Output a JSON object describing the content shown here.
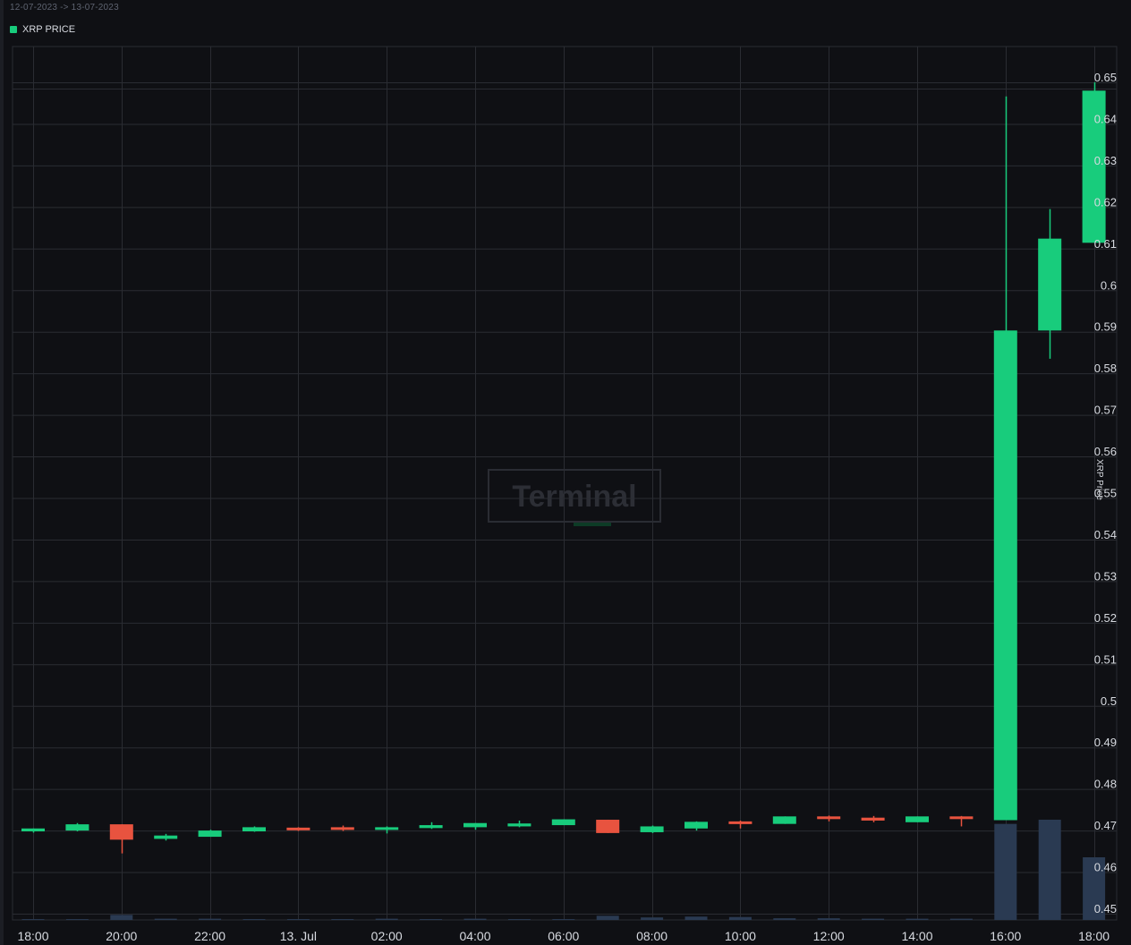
{
  "header": {
    "date_range": "12-07-2023 -> 13-07-2023",
    "legend_label": "XRP PRICE",
    "legend_color": "#18cc7c"
  },
  "watermark": {
    "text": "Terminal"
  },
  "colors": {
    "up": "#18cc7c",
    "down": "#e8533f",
    "volume": "#2a3a52",
    "grid": "#2a2c32",
    "axis_text": "#d7dae0"
  },
  "chart_data": {
    "type": "candlestick",
    "title": "",
    "series_name": "XRP PRICE",
    "ylabel": "XRP Price",
    "ylim": [
      0.45,
      0.655
    ],
    "y_ticks": [
      0.45,
      0.46,
      0.47,
      0.48,
      0.49,
      0.5,
      0.51,
      0.52,
      0.53,
      0.54,
      0.55,
      0.56,
      0.57,
      0.58,
      0.59,
      0.6,
      0.61,
      0.62,
      0.63,
      0.64,
      0.65
    ],
    "y_tick_labels": [
      "0.45",
      "0.46",
      "0.47",
      "0.48",
      "0.49",
      "0.5",
      "0.51",
      "0.52",
      "0.53",
      "0.54",
      "0.55",
      "0.56",
      "0.57",
      "0.58",
      "0.59",
      "0.6",
      "0.61",
      "0.62",
      "0.63",
      "0.64",
      "0.65"
    ],
    "x_tick_labels": [
      "18:00",
      "20:00",
      "22:00",
      "13. Jul",
      "02:00",
      "04:00",
      "06:00",
      "08:00",
      "10:00",
      "12:00",
      "14:00",
      "16:00",
      "18:00"
    ],
    "grid": true,
    "candles": [
      {
        "time": "18:00",
        "open": 0.4698,
        "high": 0.4705,
        "low": 0.4695,
        "close": 0.4705,
        "volume": 0.2
      },
      {
        "time": "19:00",
        "open": 0.47,
        "high": 0.4718,
        "low": 0.4698,
        "close": 0.4715,
        "volume": 0.2
      },
      {
        "time": "20:00",
        "open": 0.4715,
        "high": 0.4715,
        "low": 0.4645,
        "close": 0.4678,
        "volume": 1.2
      },
      {
        "time": "21:00",
        "open": 0.468,
        "high": 0.4692,
        "low": 0.4676,
        "close": 0.4688,
        "volume": 0.3
      },
      {
        "time": "22:00",
        "open": 0.4685,
        "high": 0.4702,
        "low": 0.4685,
        "close": 0.47,
        "volume": 0.3
      },
      {
        "time": "23:00",
        "open": 0.4698,
        "high": 0.471,
        "low": 0.4697,
        "close": 0.4708,
        "volume": 0.2
      },
      {
        "time": "00:00",
        "open": 0.4707,
        "high": 0.4708,
        "low": 0.4699,
        "close": 0.4703,
        "volume": 0.2
      },
      {
        "time": "01:00",
        "open": 0.4708,
        "high": 0.4712,
        "low": 0.4699,
        "close": 0.4703,
        "volume": 0.2
      },
      {
        "time": "02:00",
        "open": 0.4703,
        "high": 0.471,
        "low": 0.4693,
        "close": 0.4708,
        "volume": 0.3
      },
      {
        "time": "03:00",
        "open": 0.4706,
        "high": 0.472,
        "low": 0.4704,
        "close": 0.4713,
        "volume": 0.2
      },
      {
        "time": "04:00",
        "open": 0.4708,
        "high": 0.4718,
        "low": 0.4702,
        "close": 0.4718,
        "volume": 0.3
      },
      {
        "time": "05:00",
        "open": 0.471,
        "high": 0.4724,
        "low": 0.4708,
        "close": 0.4717,
        "volume": 0.2
      },
      {
        "time": "06:00",
        "open": 0.4713,
        "high": 0.4727,
        "low": 0.4713,
        "close": 0.4727,
        "volume": 0.2
      },
      {
        "time": "07:00",
        "open": 0.4726,
        "high": 0.4726,
        "low": 0.4694,
        "close": 0.4694,
        "volume": 1.0
      },
      {
        "time": "08:00",
        "open": 0.4696,
        "high": 0.4712,
        "low": 0.4694,
        "close": 0.471,
        "volume": 0.6
      },
      {
        "time": "09:00",
        "open": 0.4705,
        "high": 0.4722,
        "low": 0.47,
        "close": 0.4721,
        "volume": 0.8
      },
      {
        "time": "10:00",
        "open": 0.4722,
        "high": 0.4724,
        "low": 0.4705,
        "close": 0.4718,
        "volume": 0.7
      },
      {
        "time": "11:00",
        "open": 0.4716,
        "high": 0.4734,
        "low": 0.4716,
        "close": 0.4734,
        "volume": 0.4
      },
      {
        "time": "12:00",
        "open": 0.4734,
        "high": 0.4736,
        "low": 0.4722,
        "close": 0.4728,
        "volume": 0.4
      },
      {
        "time": "13:00",
        "open": 0.4731,
        "high": 0.4735,
        "low": 0.472,
        "close": 0.4724,
        "volume": 0.3
      },
      {
        "time": "14:00",
        "open": 0.472,
        "high": 0.4734,
        "low": 0.472,
        "close": 0.4734,
        "volume": 0.3
      },
      {
        "time": "15:00",
        "open": 0.4734,
        "high": 0.4735,
        "low": 0.471,
        "close": 0.4728,
        "volume": 0.3
      },
      {
        "time": "16:00",
        "open": 0.4725,
        "high": 0.6466,
        "low": 0.4725,
        "close": 0.5903,
        "volume": 23.0
      },
      {
        "time": "17:00",
        "open": 0.5903,
        "high": 0.6195,
        "low": 0.5835,
        "close": 0.6124,
        "volume": 24.0
      },
      {
        "time": "18:00",
        "open": 0.6114,
        "high": 0.65,
        "low": 0.6114,
        "close": 0.648,
        "volume": 15.0
      }
    ]
  }
}
